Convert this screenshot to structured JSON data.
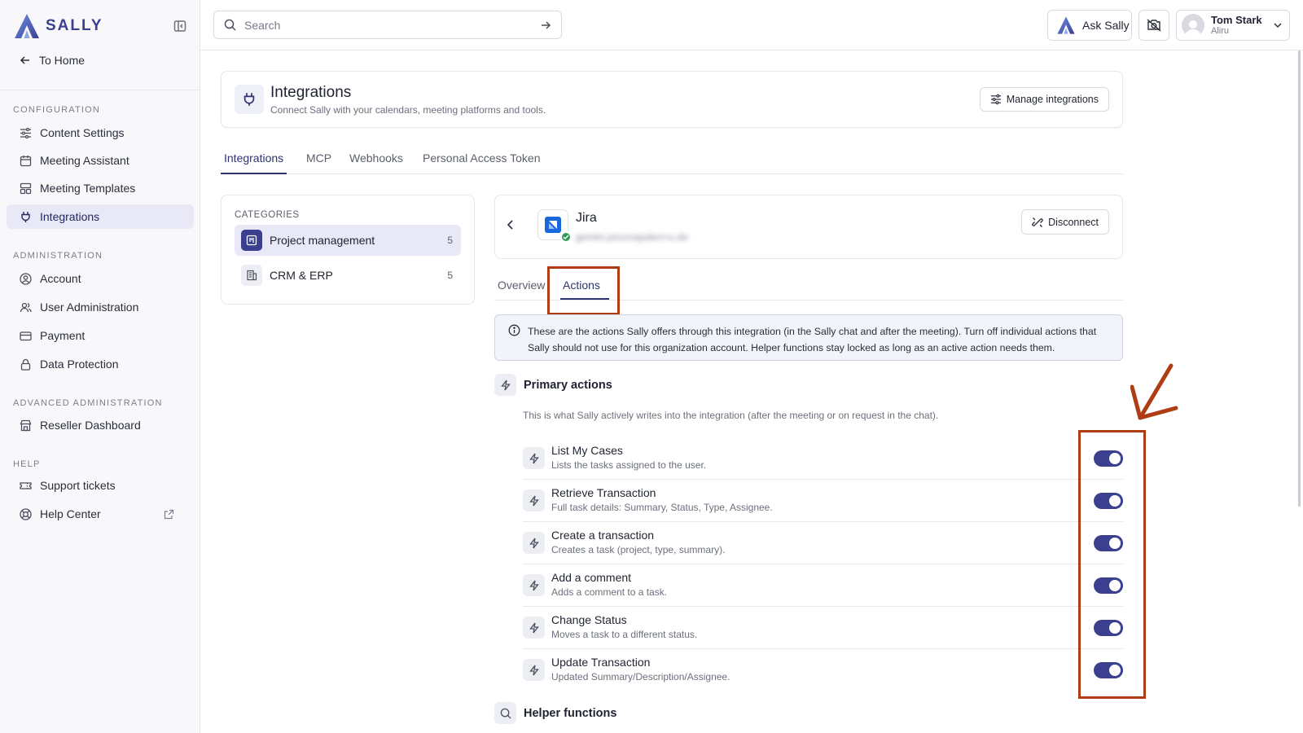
{
  "brand": {
    "name": "SALLY",
    "accent": "#3a3f8f",
    "annotation_color": "#b03c14"
  },
  "sidebar": {
    "to_home": "To Home",
    "sections": {
      "configuration": "CONFIGURATION",
      "administration": "ADMINISTRATION",
      "advanced": "ADVANCED ADMINISTRATION",
      "help": "HELP"
    },
    "items": [
      {
        "label": "Content Settings",
        "icon": "sliders-icon"
      },
      {
        "label": "Meeting Assistant",
        "icon": "calendar-icon"
      },
      {
        "label": "Meeting Templates",
        "icon": "template-icon"
      },
      {
        "label": "Integrations",
        "icon": "plug-icon",
        "active": true
      },
      {
        "label": "Account",
        "icon": "user-circle-icon"
      },
      {
        "label": "User Administration",
        "icon": "users-icon"
      },
      {
        "label": "Payment",
        "icon": "credit-card-icon"
      },
      {
        "label": "Data Protection",
        "icon": "lock-icon"
      },
      {
        "label": "Reseller Dashboard",
        "icon": "store-icon"
      },
      {
        "label": "Support tickets",
        "icon": "ticket-icon"
      },
      {
        "label": "Help Center",
        "icon": "lifebuoy-icon"
      }
    ]
  },
  "header": {
    "search_placeholder": "Search",
    "ask_label": "Ask Sally",
    "user_name": "Tom Stark",
    "user_org": "Aliru"
  },
  "page": {
    "title": "Integrations",
    "subtitle": "Connect Sally with your calendars, meeting platforms and tools.",
    "manage_label": "Manage integrations",
    "tabs": [
      "Integrations",
      "MCP",
      "Webhooks",
      "Personal Access Token"
    ]
  },
  "categories": {
    "label": "CATEGORIES",
    "items": [
      {
        "label": "Project management",
        "count": "5"
      },
      {
        "label": "CRM & ERP",
        "count": "5"
      }
    ]
  },
  "integration": {
    "name": "Jira",
    "account": "gemini.jorucoapalen+u.de",
    "disconnect_label": "Disconnect",
    "subtabs": [
      "Overview",
      "Actions"
    ],
    "info": "These are the actions Sally offers through this integration (in the Sally chat and after the meeting). Turn off individual actions that Sally should not use for this organization account. Helper functions stay locked as long as an active action needs them."
  },
  "primary": {
    "heading": "Primary actions",
    "description": "This is what Sally actively writes into the integration (after the meeting or on request in the chat).",
    "actions": [
      {
        "title": "List My Cases",
        "desc": "Lists the tasks assigned to the user.",
        "enabled": true
      },
      {
        "title": "Retrieve Transaction",
        "desc": "Full task details: Summary, Status, Type, Assignee.",
        "enabled": true
      },
      {
        "title": "Create a transaction",
        "desc": "Creates a task (project, type, summary).",
        "enabled": true
      },
      {
        "title": "Add a comment",
        "desc": "Adds a comment to a task.",
        "enabled": true
      },
      {
        "title": "Change Status",
        "desc": "Moves a task to a different status.",
        "enabled": true
      },
      {
        "title": "Update Transaction",
        "desc": "Updated Summary/Description/Assignee.",
        "enabled": true
      }
    ]
  },
  "helper": {
    "heading": "Helper functions"
  }
}
